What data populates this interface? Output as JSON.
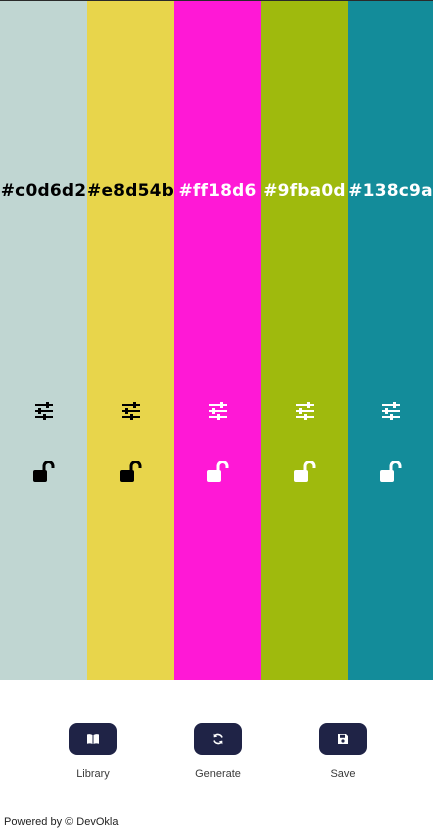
{
  "swatches": [
    {
      "hex": "#c0d6d2",
      "color": "#c0d6d2",
      "text_color": "#000000"
    },
    {
      "hex": "#e8d54b",
      "color": "#e8d54b",
      "text_color": "#000000"
    },
    {
      "hex": "#ff18d6",
      "color": "#ff18d6",
      "text_color": "#ffffff"
    },
    {
      "hex": "#9fba0d",
      "color": "#9fba0d",
      "text_color": "#ffffff"
    },
    {
      "hex": "#138c9a",
      "color": "#138c9a",
      "text_color": "#ffffff"
    }
  ],
  "swatch_icons": {
    "adjust": "sliders-icon",
    "lock": "unlocked-padlock-icon"
  },
  "actions": {
    "library": {
      "label": "Library",
      "icon": "book-icon"
    },
    "generate": {
      "label": "Generate",
      "icon": "refresh-icon"
    },
    "save": {
      "label": "Save",
      "icon": "floppy-disk-icon"
    }
  },
  "button_color": "#1f2346",
  "footer": {
    "text": "Powered by © DevOkla"
  }
}
